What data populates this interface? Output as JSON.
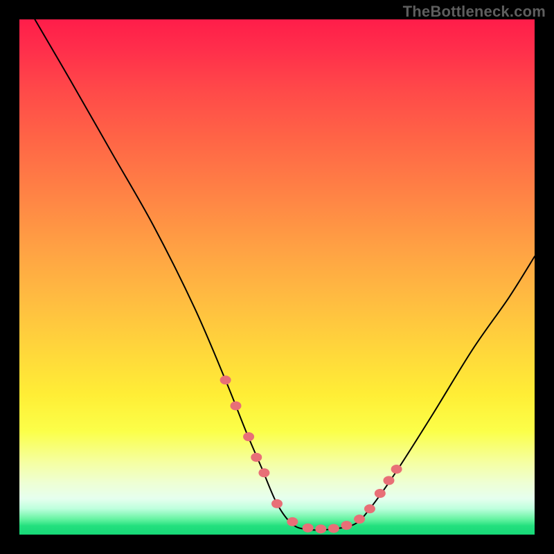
{
  "watermark": "TheBottleneck.com",
  "chart_data": {
    "type": "line",
    "title": "",
    "xlabel": "",
    "ylabel": "",
    "xlim": [
      0,
      100
    ],
    "ylim": [
      0,
      100
    ],
    "series": [
      {
        "name": "curve",
        "x": [
          3,
          10,
          18,
          26,
          34,
          40,
          44,
          47,
          50,
          53,
          56,
          60,
          65,
          68,
          73,
          80,
          88,
          95,
          100
        ],
        "y": [
          100,
          88,
          74,
          60,
          44,
          30,
          20,
          13,
          6,
          2,
          1,
          1,
          2,
          5,
          12,
          23,
          36,
          46,
          54
        ]
      },
      {
        "name": "markers",
        "x": [
          40,
          42,
          44.5,
          46,
          47.5,
          50,
          53,
          56,
          58.5,
          61,
          63.5,
          66,
          68,
          70,
          71.7,
          73.2
        ],
        "y": [
          30,
          25,
          19,
          15,
          12,
          6,
          2.5,
          1.3,
          1.1,
          1.2,
          1.8,
          3.0,
          5.0,
          8.0,
          10.5,
          12.7
        ]
      }
    ],
    "colors": {
      "curve": "#000000",
      "marker": "#e86f77"
    }
  }
}
